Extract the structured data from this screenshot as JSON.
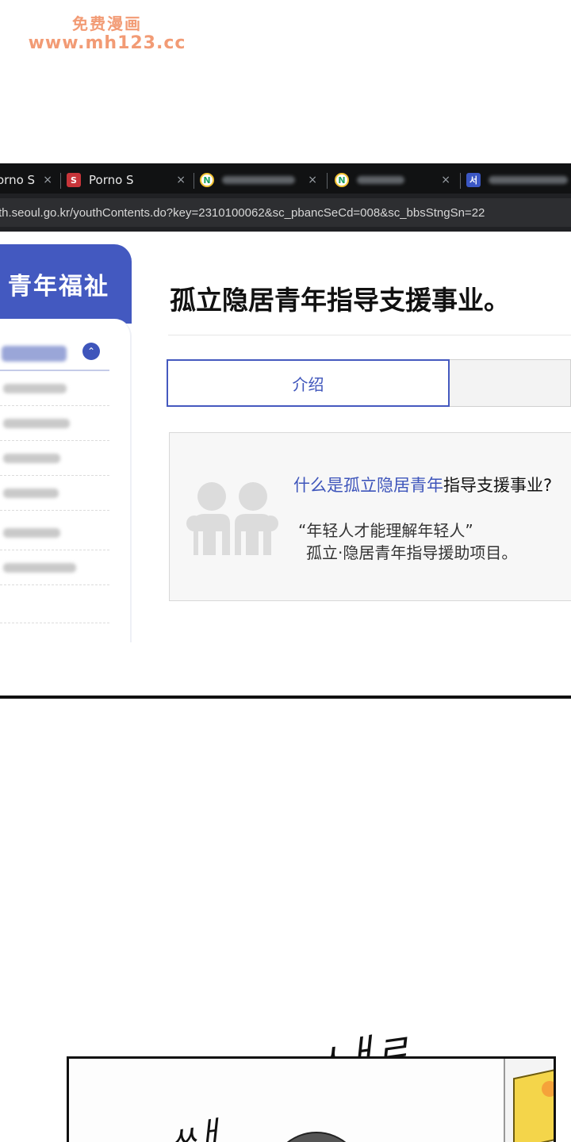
{
  "watermark": {
    "line1": "免费漫画",
    "line2": "www.mh123.cc"
  },
  "browser": {
    "tabs": [
      {
        "label": "orno S",
        "icon": "s-favicon-icon"
      },
      {
        "label": "Porno S",
        "icon": "s-favicon-icon",
        "favicon_letter": "S"
      },
      {
        "label": "",
        "icon": "n-favicon-icon",
        "favicon_letter": "N"
      },
      {
        "label": "",
        "icon": "n-favicon-icon",
        "favicon_letter": "N"
      },
      {
        "label": "",
        "icon": "seoul-favicon-icon",
        "favicon_letter": "서"
      }
    ],
    "close_glyph": "×",
    "url": "th.seoul.go.kr/youthContents.do?key=2310100062&sc_pbancSeCd=008&sc_bbsStngSn=22"
  },
  "sidebar": {
    "title": "青年福祉",
    "toggle_glyph": "⌃"
  },
  "main": {
    "title": "孤立隐居青年指导支援事业。",
    "tabs": [
      {
        "label": "介绍"
      },
      {
        "label": ""
      }
    ],
    "intro": {
      "question_highlight": "什么是孤立隐居青年",
      "question_rest": "指导支援事业?",
      "quote_line1": "“年轻人才能理解年轻人”",
      "quote_line2": "孤立·隐居青年指导援助项目。"
    }
  },
  "comic": {
    "sfx1": "ㅅㅐㄹ",
    "sfx2": "ㅆㅐ"
  },
  "colors": {
    "accent": "#4359c0",
    "tab_bar": "#111213",
    "url_bar": "#2d2e31"
  }
}
